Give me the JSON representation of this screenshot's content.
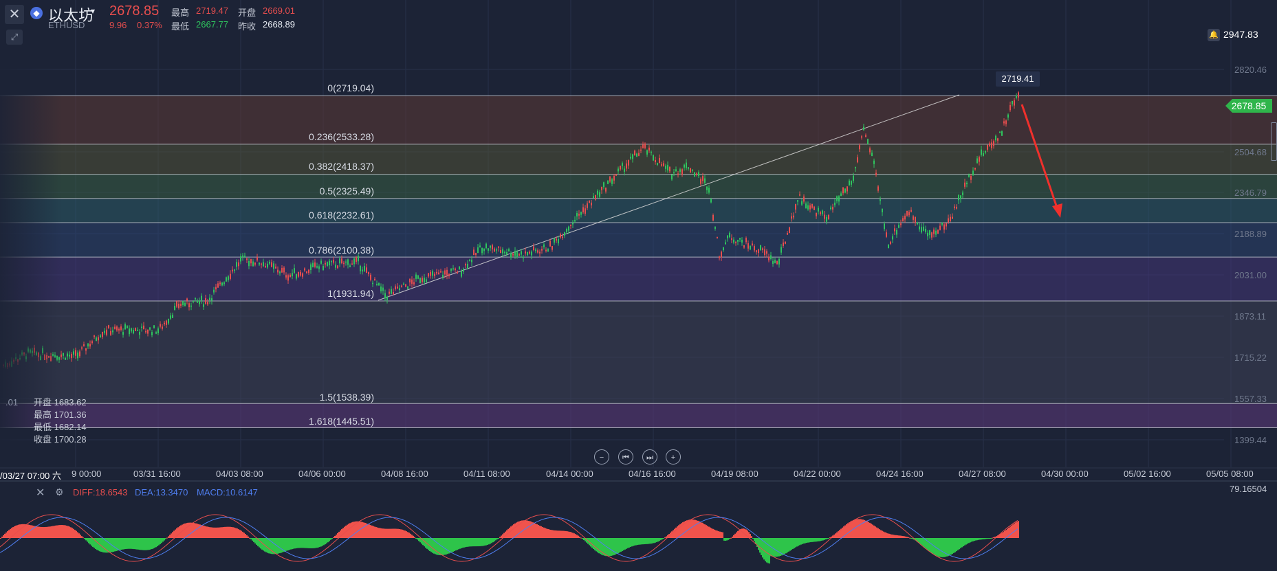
{
  "header": {
    "symbol_name": "以太坊",
    "symbol_code": "ETHUSD",
    "last_price": "2678.85",
    "change": "9.96",
    "change_pct": "0.37%",
    "high_label": "最高",
    "high_value": "2719.47",
    "open_label": "开盘",
    "open_value": "2669.01",
    "low_label": "最低",
    "low_value": "2667.77",
    "prev_close_label": "昨收",
    "prev_close_value": "2668.89",
    "eth_glyph": "◆",
    "caret_glyph": "▾",
    "close_glyph": "✕",
    "draw_glyph": "⤢"
  },
  "right_panel": {
    "top_price": "2947.83",
    "current_price_tag": "2678.85",
    "high_marker": "2719.41",
    "y_ticks": [
      "2820.46",
      "2504.68",
      "2346.79",
      "2188.89",
      "2031.00",
      "1873.11",
      "1715.22",
      "1557.33",
      "1399.44"
    ],
    "bell_glyph": "🔔"
  },
  "fib_levels": [
    {
      "label": "0(2719.04)",
      "price": 2719.04
    },
    {
      "label": "0.236(2533.28)",
      "price": 2533.28
    },
    {
      "label": "0.382(2418.37)",
      "price": 2418.37
    },
    {
      "label": "0.5(2325.49)",
      "price": 2325.49
    },
    {
      "label": "0.618(2232.61)",
      "price": 2232.61
    },
    {
      "label": "0.786(2100.38)",
      "price": 2100.38
    },
    {
      "label": "1(1931.94)",
      "price": 1931.94
    },
    {
      "label": "1.5(1538.39)",
      "price": 1538.39
    },
    {
      "label": "1.618(1445.51)",
      "price": 1445.51
    }
  ],
  "crosshair_ohlc": {
    "open": "开盘 1683.62",
    "high": "最高 1701.36",
    "low": "最低 1682.14",
    "close": "收盘 1700.28",
    "left_edge_value": ".01"
  },
  "x_axis": {
    "crosshair_time": "/03/27 07:00 六",
    "partial_first": "9 00:00",
    "ticks": [
      "03/31 16:00",
      "04/03 08:00",
      "04/06 00:00",
      "04/08 16:00",
      "04/11 08:00",
      "04/14 00:00",
      "04/16 16:00",
      "04/19 08:00",
      "04/22 00:00",
      "04/24 16:00",
      "04/27 08:00",
      "04/30 00:00",
      "05/02 16:00",
      "05/05 08:00"
    ]
  },
  "nav_buttons": {
    "zoom_out": "−",
    "to_start": "⏮",
    "to_end": "⏭",
    "zoom_in": "+"
  },
  "macd": {
    "diff": "DIFF:18.6543",
    "dea": "DEA:13.3470",
    "macd": "MACD:10.6147",
    "max_value": "79.16504",
    "close_glyph": "✕",
    "gear_glyph": "⚙"
  },
  "colors": {
    "up": "#e84e4e",
    "down": "#2fc45e",
    "arrow": "#f0302c",
    "background": "#1c2336"
  }
}
